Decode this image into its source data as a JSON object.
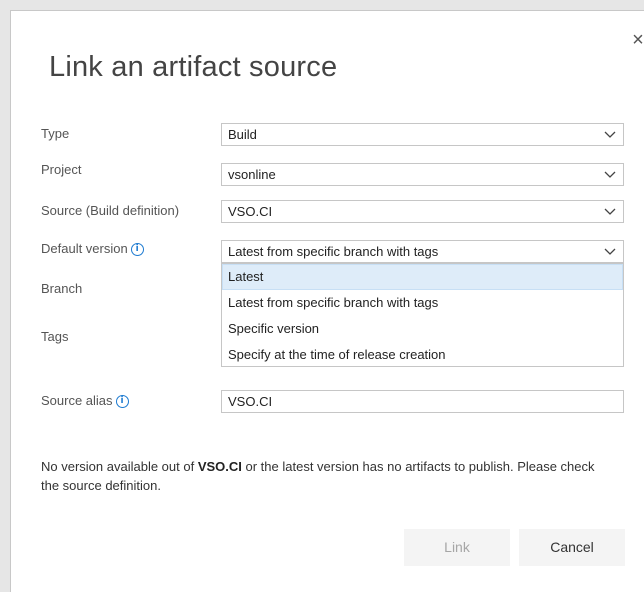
{
  "dialog": {
    "title": "Link an artifact source",
    "close_glyph": "×"
  },
  "form": {
    "type_label": "Type",
    "type_value": "Build",
    "project_label": "Project",
    "project_value": "vsonline",
    "source_label": "Source (Build definition)",
    "source_value": "VSO.CI",
    "default_version_label": "Default version",
    "default_version_value": "Latest from specific branch with tags",
    "branch_label": "Branch",
    "tags_label": "Tags",
    "source_alias_label": "Source alias",
    "source_alias_value": "VSO.CI"
  },
  "dropdown": {
    "options": [
      "Latest",
      "Latest from specific branch with tags",
      "Specific version",
      "Specify at the time of release creation"
    ],
    "highlighted": "Latest"
  },
  "message": {
    "before": "No version available out of ",
    "bold": "VSO.CI",
    "after": " or the latest version has no artifacts to publish. Please check the source definition."
  },
  "buttons": {
    "link_label": "Link",
    "cancel_label": "Cancel"
  },
  "icons": {
    "info": "info-icon",
    "chevron": "chevron-down-icon",
    "close": "close-icon"
  },
  "colors": {
    "accent": "#1e7bd1",
    "highlight": "#deecf9"
  }
}
